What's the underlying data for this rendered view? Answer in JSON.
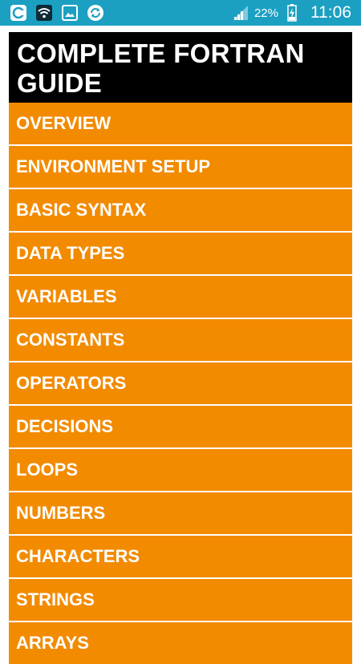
{
  "status_bar": {
    "battery_percent": "22%",
    "time": "11:06",
    "icons": [
      "app-icon",
      "wifi-icon",
      "gallery-icon",
      "sync-icon",
      "signal-icon",
      "battery-charging-icon"
    ]
  },
  "header": {
    "title": "COMPLETE FORTRAN GUIDE"
  },
  "menu": {
    "items": [
      {
        "label": "OVERVIEW"
      },
      {
        "label": "ENVIRONMENT SETUP"
      },
      {
        "label": "BASIC SYNTAX"
      },
      {
        "label": "DATA TYPES"
      },
      {
        "label": "VARIABLES"
      },
      {
        "label": "CONSTANTS"
      },
      {
        "label": "OPERATORS"
      },
      {
        "label": "DECISIONS"
      },
      {
        "label": "LOOPS"
      },
      {
        "label": "NUMBERS"
      },
      {
        "label": "CHARACTERS"
      },
      {
        "label": "STRINGS"
      },
      {
        "label": "ARRAYS"
      }
    ]
  },
  "colors": {
    "status_bar": "#1ba0c2",
    "title_bg": "#000000",
    "item_bg": "#f28b00",
    "text": "#ffffff"
  }
}
